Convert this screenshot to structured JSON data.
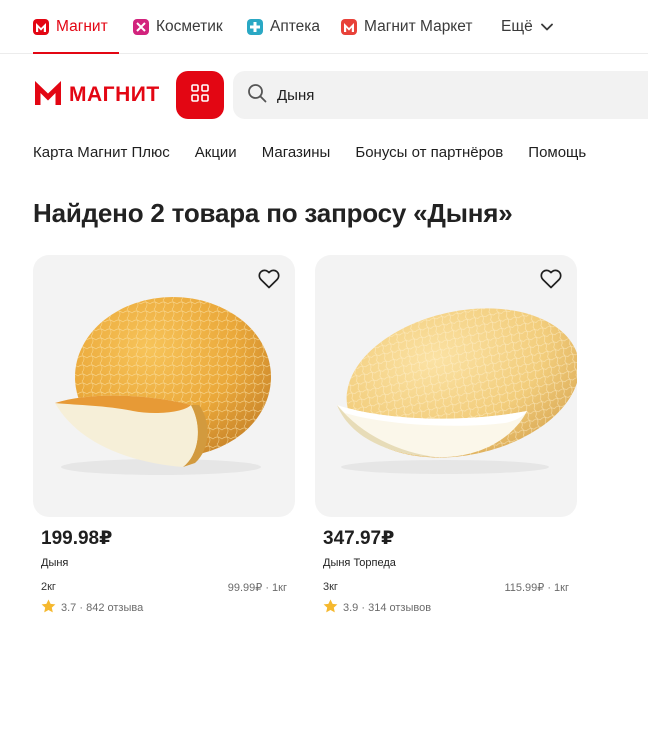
{
  "brand_tabs": [
    {
      "label": "Магнит",
      "icon": "magnit-icon",
      "color": "#e30613",
      "active": true
    },
    {
      "label": "Косметик",
      "icon": "kosmetik-icon",
      "color": "#d2237d",
      "active": false
    },
    {
      "label": "Аптека",
      "icon": "apteka-cross-icon",
      "color": "#2aa8c4",
      "active": false
    },
    {
      "label": "Магнит Маркет",
      "icon": "market-icon",
      "color": "#e8423a",
      "active": false
    }
  ],
  "more_label": "Ещё",
  "header": {
    "logo_text": "МАГНИТ",
    "search_value": "Дыня"
  },
  "nav": [
    "Карта Магнит Плюс",
    "Акции",
    "Магазины",
    "Бонусы от партнёров",
    "Помощь"
  ],
  "title": "Найдено 2 товара по запросу «Дыня»",
  "products": [
    {
      "price": "199.98₽",
      "name": "Дыня",
      "weight": "2кг",
      "unit_price": "99.99₽ · 1кг",
      "rating": "3.7",
      "reviews": "842 отзыва"
    },
    {
      "price": "347.97₽",
      "name": "Дыня Торпеда",
      "weight": "3кг",
      "unit_price": "115.99₽ · 1кг",
      "rating": "3.9",
      "reviews": "314 отзывов"
    }
  ],
  "colors": {
    "brand_red": "#e30613",
    "star": "#f5b82e",
    "search_bg": "#f2f2f2",
    "card_bg": "#f3f3f3"
  }
}
